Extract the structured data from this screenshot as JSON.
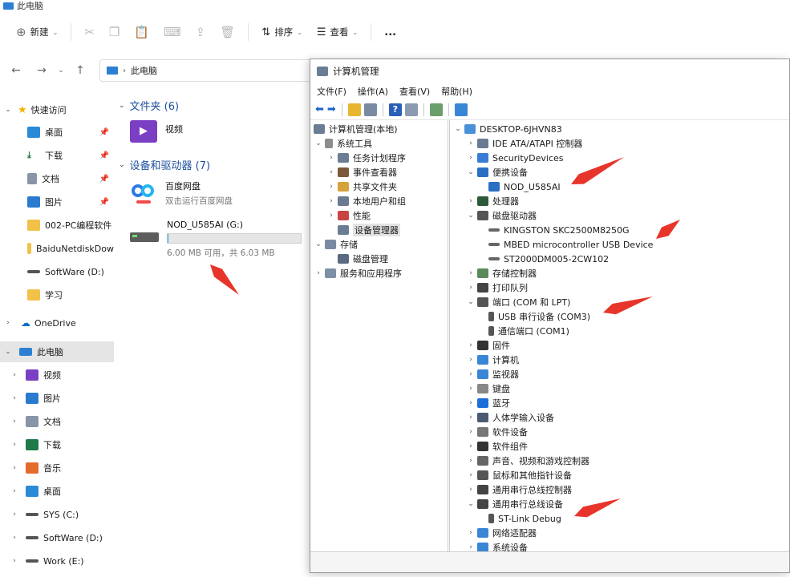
{
  "explorer": {
    "title": "此电脑",
    "toolbar": {
      "new_label": "新建",
      "sort_label": "排序",
      "view_label": "查看",
      "more_label": "..."
    },
    "address": {
      "location": "此电脑"
    },
    "sidebar": {
      "quick_access": "快速访问",
      "pinned": [
        "桌面",
        "下载",
        "文档",
        "图片"
      ],
      "folders": [
        "002-PC编程软件",
        "BaiduNetdiskDow",
        "SoftWare (D:)",
        "学习"
      ],
      "onedrive": "OneDrive",
      "this_pc": "此电脑",
      "pc_children": [
        "视频",
        "图片",
        "文档",
        "下载",
        "音乐",
        "桌面",
        "SYS (C:)",
        "SoftWare (D:)",
        "Work (E:)"
      ]
    },
    "main": {
      "folders_header": "文件夹 (6)",
      "folder_item": "视频",
      "devices_header": "设备和驱动器 (7)",
      "baidu_title": "百度网盘",
      "baidu_sub": "双击运行百度网盘",
      "drive_title": "NOD_U585AI (G:)",
      "drive_sub": "6.00 MB 可用，共 6.03 MB",
      "drive_free_mb": 6.0,
      "drive_total_mb": 6.03
    }
  },
  "computer_management": {
    "title": "计算机管理",
    "menu": [
      "文件(F)",
      "操作(A)",
      "查看(V)",
      "帮助(H)"
    ],
    "left_tree": {
      "root": "计算机管理(本地)",
      "system_tools": "系统工具",
      "system_children": [
        "任务计划程序",
        "事件查看器",
        "共享文件夹",
        "本地用户和组",
        "性能",
        "设备管理器"
      ],
      "storage": "存储",
      "storage_children": [
        "磁盘管理"
      ],
      "services": "服务和应用程序"
    },
    "device_tree": {
      "root": "DESKTOP-6JHVN83",
      "categories": [
        {
          "label": "IDE ATA/ATAPI 控制器",
          "expanded": false,
          "children": []
        },
        {
          "label": "SecurityDevices",
          "expanded": false,
          "children": []
        },
        {
          "label": "便携设备",
          "expanded": true,
          "children": [
            "NOD_U585AI"
          ]
        },
        {
          "label": "处理器",
          "expanded": false,
          "children": []
        },
        {
          "label": "磁盘驱动器",
          "expanded": true,
          "children": [
            "KINGSTON SKC2500M8250G",
            "MBED microcontroller USB Device",
            "ST2000DM005-2CW102"
          ]
        },
        {
          "label": "存储控制器",
          "expanded": false,
          "children": []
        },
        {
          "label": "打印队列",
          "expanded": false,
          "children": []
        },
        {
          "label": "端口 (COM 和 LPT)",
          "expanded": true,
          "children": [
            "USB 串行设备 (COM3)",
            "通信端口 (COM1)"
          ]
        },
        {
          "label": "固件",
          "expanded": false,
          "children": []
        },
        {
          "label": "计算机",
          "expanded": false,
          "children": []
        },
        {
          "label": "监视器",
          "expanded": false,
          "children": []
        },
        {
          "label": "键盘",
          "expanded": false,
          "children": []
        },
        {
          "label": "蓝牙",
          "expanded": false,
          "children": []
        },
        {
          "label": "人体学输入设备",
          "expanded": false,
          "children": []
        },
        {
          "label": "软件设备",
          "expanded": false,
          "children": []
        },
        {
          "label": "软件组件",
          "expanded": false,
          "children": []
        },
        {
          "label": "声音、视频和游戏控制器",
          "expanded": false,
          "children": []
        },
        {
          "label": "鼠标和其他指针设备",
          "expanded": false,
          "children": []
        },
        {
          "label": "通用串行总线控制器",
          "expanded": false,
          "children": []
        },
        {
          "label": "通用串行总线设备",
          "expanded": true,
          "children": [
            "ST-Link Debug"
          ]
        },
        {
          "label": "网络适配器",
          "expanded": false,
          "children": []
        },
        {
          "label": "系统设备",
          "expanded": false,
          "children": []
        }
      ]
    }
  },
  "colors": {
    "accent_blue": "#1c4f9e",
    "annotation_red": "#e8352b",
    "folder_yellow": "#f2c248",
    "selection_gray": "#e5e5e5"
  }
}
